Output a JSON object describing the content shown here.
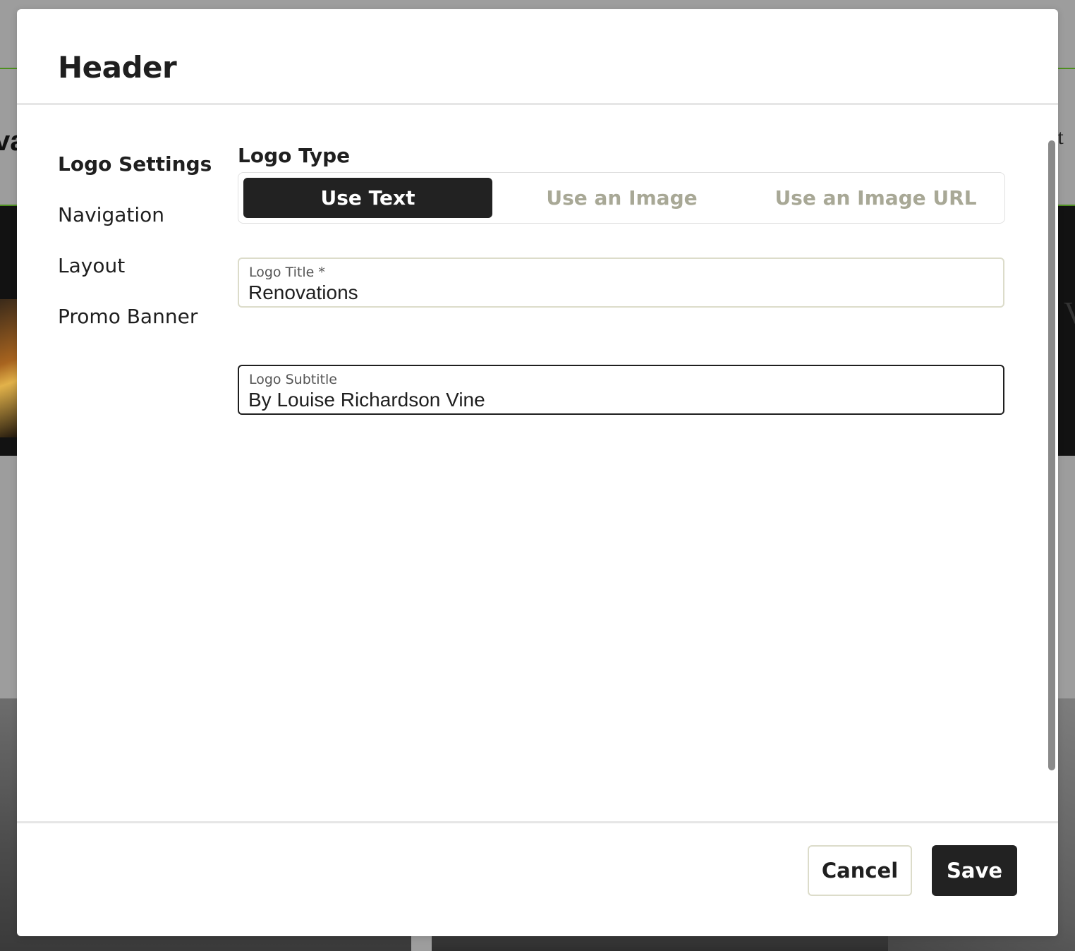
{
  "background": {
    "left_fragment": "va",
    "right_fragment": "ct",
    "right_fragment_2": "V"
  },
  "modal": {
    "title": "Header",
    "nav": {
      "items": [
        {
          "label": "Logo Settings",
          "active": true
        },
        {
          "label": "Navigation",
          "active": false
        },
        {
          "label": "Layout",
          "active": false
        },
        {
          "label": "Promo Banner",
          "active": false
        }
      ]
    },
    "logo_type": {
      "label": "Logo Type",
      "options": [
        "Use Text",
        "Use an Image",
        "Use an Image URL"
      ],
      "selected": "Use Text"
    },
    "logo_title": {
      "label": "Logo Title *",
      "value": "Renovations"
    },
    "logo_subtitle": {
      "label": "Logo Subtitle",
      "value": "By Louise Richardson Vine"
    },
    "footer": {
      "cancel_label": "Cancel",
      "save_label": "Save"
    }
  },
  "colors": {
    "primary_dark": "#222222",
    "muted_option": "#a8a896",
    "accent_green": "#4d8f1f",
    "overlay": "#9d9d9d"
  }
}
